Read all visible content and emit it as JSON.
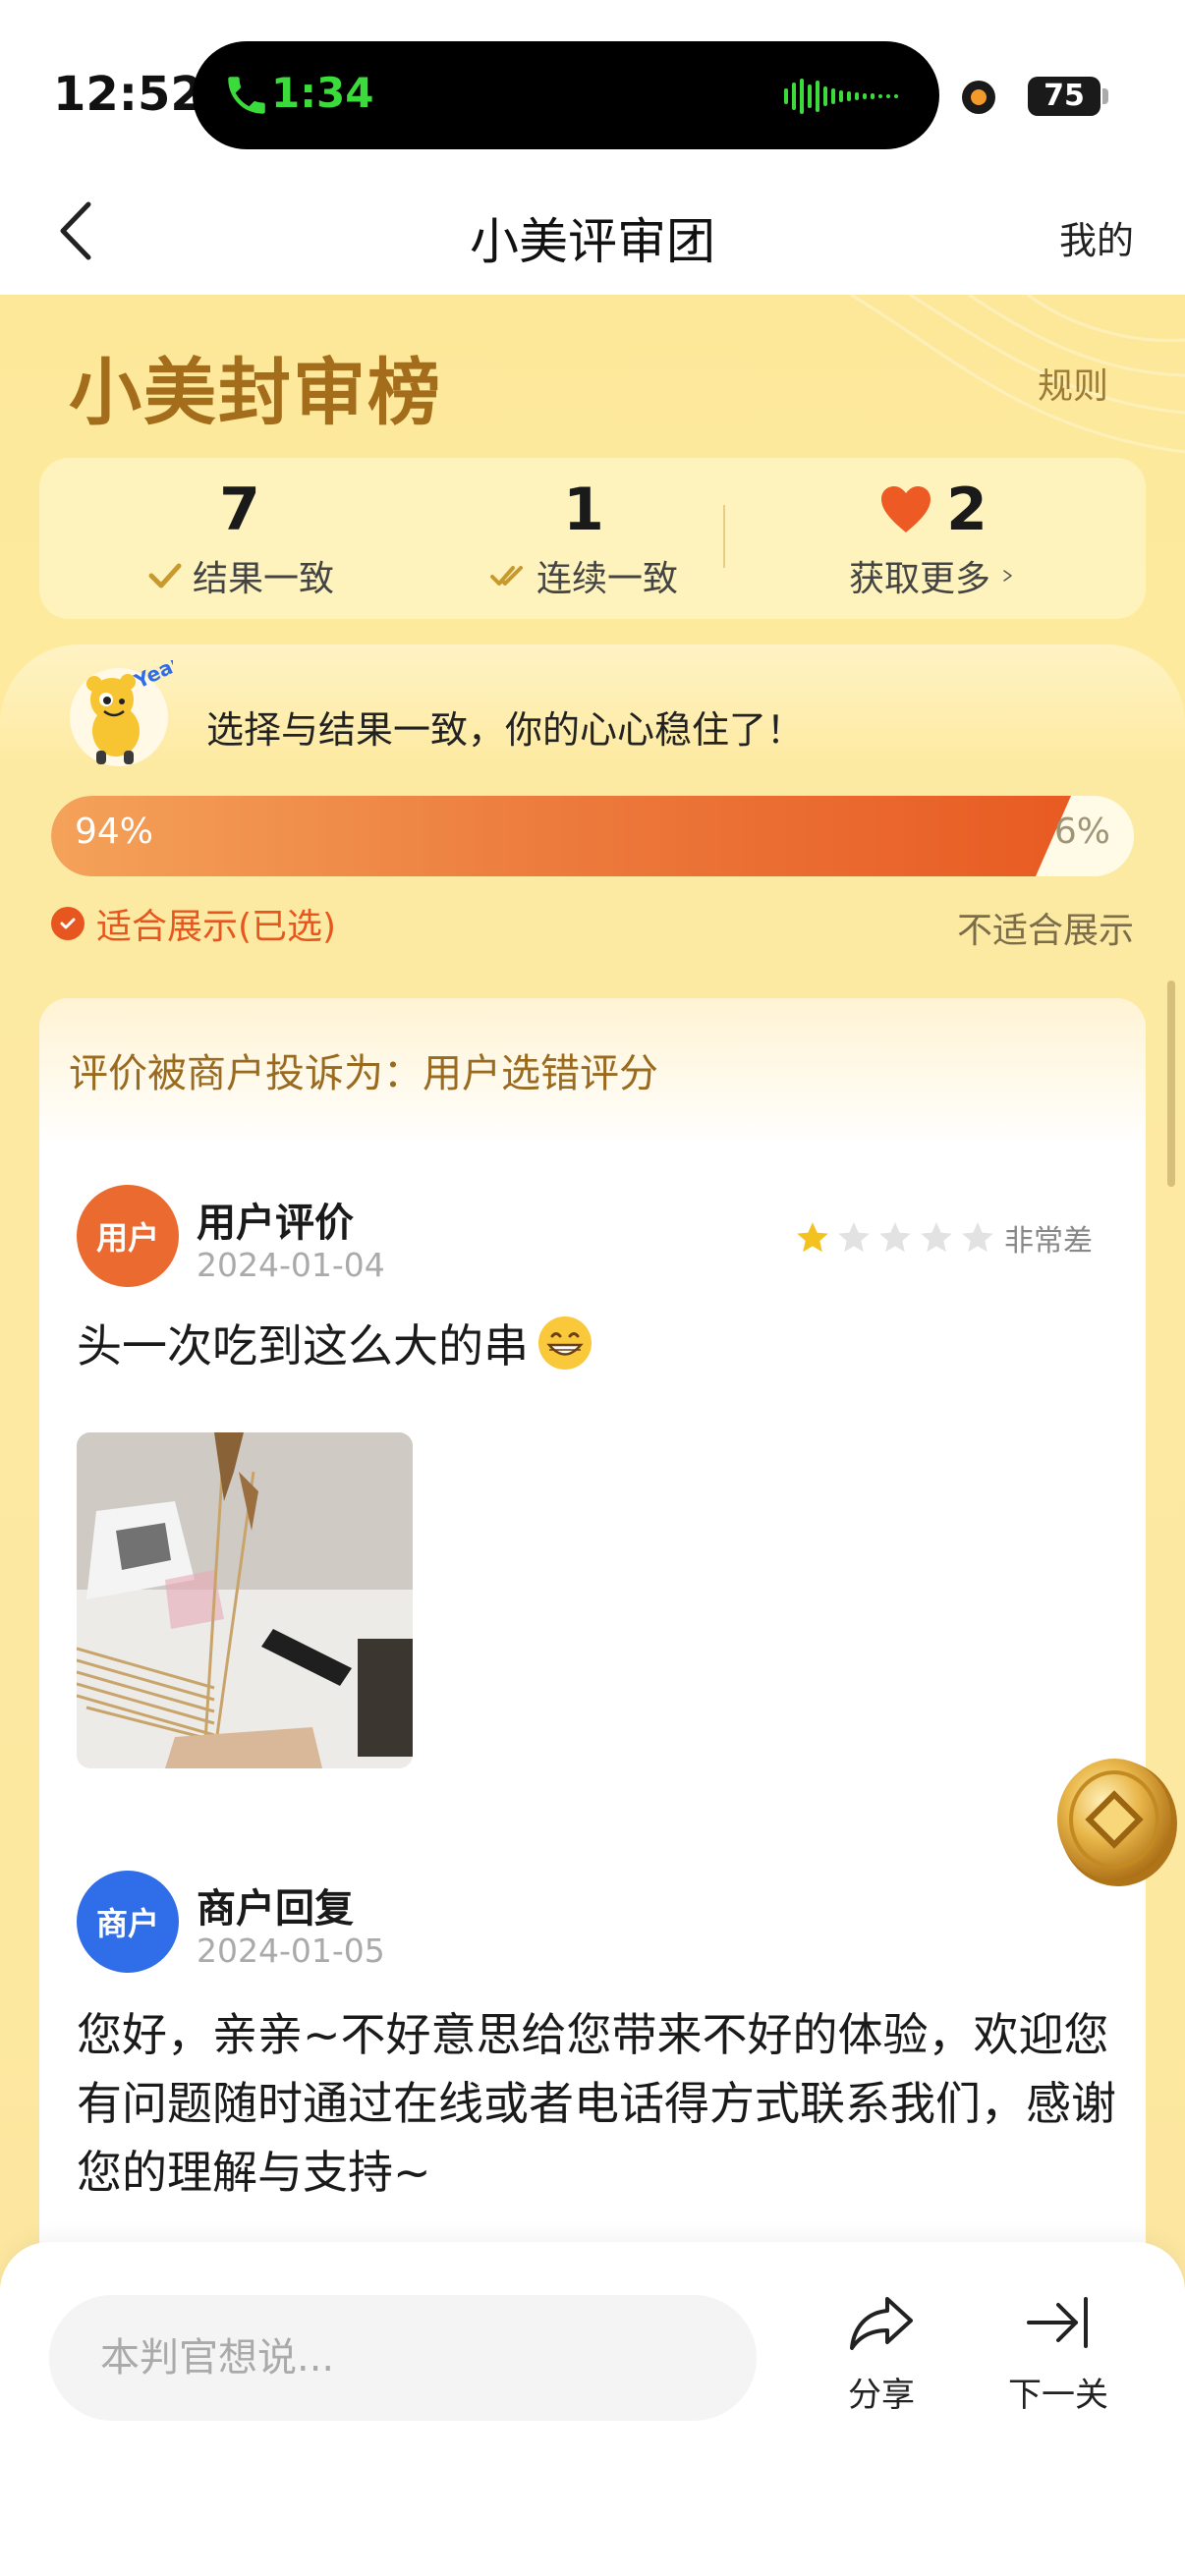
{
  "status_bar": {
    "time": "12:52",
    "call_time": "1:34",
    "battery": "75"
  },
  "nav": {
    "title": "小美评审团",
    "right_link": "我的"
  },
  "header": {
    "brand_title": "小美封审榜",
    "rules_link": "规则"
  },
  "stats": {
    "result_match_count": "7",
    "result_match_label": "结果一致",
    "streak_count": "1",
    "streak_label": "连续一致",
    "hearts_count": "2",
    "get_more_label": "获取更多"
  },
  "vote": {
    "message": "选择与结果一致，你的心心稳住了！",
    "left_percent_value": 94,
    "left_percent": "94%",
    "right_percent": "6%",
    "left_option": "适合展示(已选)",
    "right_option": "不适合展示"
  },
  "review": {
    "complaint": "评价被商户投诉为：用户选错评分",
    "user_avatar_label": "用户",
    "user_author": "用户评价",
    "user_date": "2024-01-04",
    "rating_value": 1,
    "rating_max": 5,
    "rating_label": "非常差",
    "user_text": "头一次吃到这么大的串",
    "merchant_avatar_label": "商户",
    "merchant_author": "商户回复",
    "merchant_date": "2024-01-05",
    "merchant_text": "您好，亲亲~不好意思给您带来不好的体验，欢迎您有问题随时通过在线或者电话得方式联系我们，感谢您的理解与支持~"
  },
  "bottom": {
    "comment_placeholder": "本判官想说...",
    "share_label": "分享",
    "next_label": "下一关"
  },
  "colors": {
    "accent": "#e8561f",
    "gold": "#a36d1b",
    "merchant_blue": "#2f6ee8",
    "star_active": "#f4c21f"
  }
}
